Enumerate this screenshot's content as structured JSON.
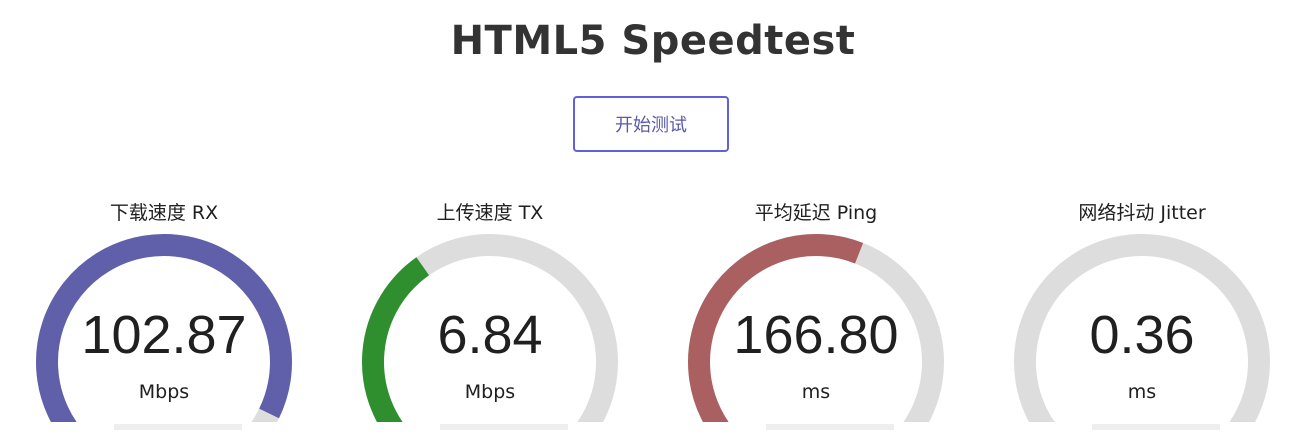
{
  "header": {
    "title": "HTML5 Speedtest"
  },
  "controls": {
    "start_label": "开始测试"
  },
  "gauges": [
    {
      "label": "下载速度 RX",
      "value": "102.87",
      "unit": "Mbps",
      "fraction": 0.93,
      "color": "#6060aa"
    },
    {
      "label": "上传速度 TX",
      "value": "6.84",
      "unit": "Mbps",
      "fraction": 0.37,
      "color": "#2f8f2f"
    },
    {
      "label": "平均延迟 Ping",
      "value": "166.80",
      "unit": "ms",
      "fraction": 0.58,
      "color": "#aa6060"
    },
    {
      "label": "网络抖动 Jitter",
      "value": "0.36",
      "unit": "ms",
      "fraction": 0.04,
      "color": "#aa6060"
    }
  ],
  "theme": {
    "track_color": "#dddddd",
    "button_border": "#6060d8",
    "button_text": "#5a5aa8"
  }
}
